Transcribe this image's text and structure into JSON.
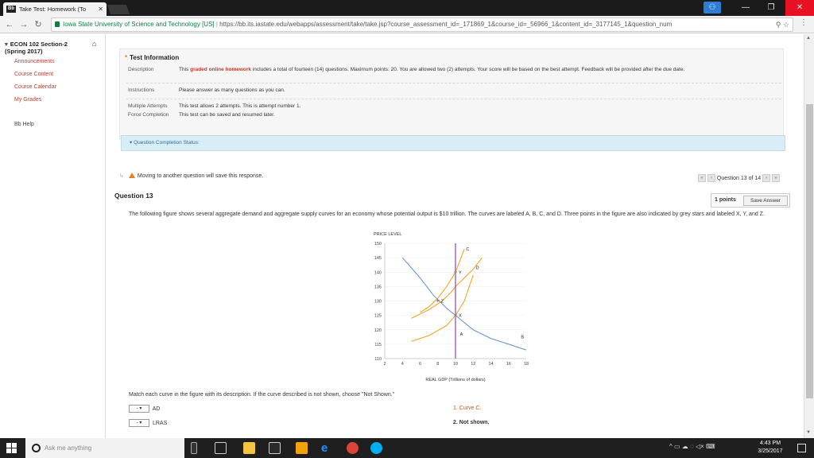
{
  "browser": {
    "tab_title": "Take Test: Homework (To",
    "tab_favicon": "Bb",
    "site_name": "Iowa State University of Science and Technology [US]",
    "url": "https://bb.its.iastate.edu/webapps/assessment/take/take.jsp?course_assessment_id=_171869_1&course_id=_56966_1&content_id=_3177145_1&question_num"
  },
  "leftnav": {
    "course_title": "ECON 102 Section-2",
    "course_term": "(Spring 2017)",
    "items": [
      "Announcements",
      "Course Content",
      "Course Calendar",
      "My Grades"
    ],
    "help": "Bb Help"
  },
  "test_info": {
    "title": "Test Information",
    "rows": [
      {
        "label": "Description",
        "pre": "This ",
        "highlight": "graded online homework",
        "post": " includes a total of fourteen (14) questions. Maximum points: 20. You are allowed two (2) attempts. Your score will be based on the best attempt. Feedback will be provided after the due date."
      },
      {
        "label": "Instructions",
        "value": "Please answer as many questions as you can."
      },
      {
        "label": "Multiple Attempts",
        "value": "This test allows 2 attempts. This is attempt number 1."
      },
      {
        "label": "Force Completion",
        "value": "This test can be saved and resumed later."
      }
    ]
  },
  "question_completion": "Question Completion Status:",
  "warning": "Moving to another question will save this response.",
  "question_nav": {
    "label": "Question 13 of 14"
  },
  "question": {
    "title": "Question 13",
    "points": "1 points",
    "save": "Save Answer",
    "text": "The following figure shows several aggregate demand and aggregate supply curves for an economy whose potential output is $10 trillion. The curves are labeled A, B, C, and D. Three points in the figure are also indicated by grey stars and labeled X, Y, and Z.",
    "match_instruction": "Match each curve in the figure with its description. If the curve described is not shown, choose \"Not Shown.\"",
    "match_rows": [
      {
        "select": "-",
        "term": "AD"
      },
      {
        "select": "-",
        "term": "LRAS"
      }
    ],
    "answers": [
      "1. Curve C.",
      "2. Not shown."
    ]
  },
  "chart_data": {
    "type": "line",
    "ylabel": "PRICE LEVEL",
    "xlabel": "REAL GDP (Trillions of dollars)",
    "xlim": [
      2,
      18
    ],
    "ylim": [
      110,
      150
    ],
    "x_ticks": [
      2,
      4,
      6,
      8,
      10,
      12,
      14,
      16,
      18
    ],
    "y_ticks": [
      110,
      115,
      120,
      125,
      130,
      135,
      140,
      145,
      150
    ],
    "series": [
      {
        "name": "A",
        "color": "#f39c12",
        "points": [
          [
            5,
            116
          ],
          [
            7,
            118
          ],
          [
            9,
            121.5
          ],
          [
            10,
            125
          ],
          [
            11,
            130
          ],
          [
            12,
            139
          ]
        ]
      },
      {
        "name": "B",
        "color": "#5b8fd6",
        "points": [
          [
            4,
            145
          ],
          [
            6,
            138
          ],
          [
            7.5,
            132
          ],
          [
            9,
            127.5
          ],
          [
            10,
            125
          ],
          [
            12,
            120
          ],
          [
            14,
            117
          ],
          [
            16,
            115
          ],
          [
            18,
            113
          ]
        ]
      },
      {
        "name": "C",
        "color": "#f39c12",
        "points": [
          [
            6,
            126
          ],
          [
            7,
            128
          ],
          [
            8,
            131
          ],
          [
            9,
            135
          ],
          [
            10,
            140
          ],
          [
            11,
            148
          ]
        ]
      },
      {
        "name": "D",
        "color": "#f39c12",
        "points": [
          [
            5,
            124
          ],
          [
            7,
            127
          ],
          [
            8.5,
            130
          ],
          [
            9.5,
            133
          ],
          [
            10,
            135
          ],
          [
            11,
            138
          ],
          [
            12,
            141
          ],
          [
            13,
            145
          ]
        ]
      },
      {
        "name": "vertical",
        "color": "#8e44ad",
        "points": [
          [
            10,
            110
          ],
          [
            10,
            150
          ]
        ]
      }
    ],
    "stars": [
      {
        "label": "X",
        "x": 10,
        "y": 125
      },
      {
        "label": "Y",
        "x": 10,
        "y": 140
      },
      {
        "label": "Z",
        "x": 8,
        "y": 130
      }
    ]
  },
  "taskbar": {
    "search_placeholder": "Ask me anything",
    "time": "4:43 PM",
    "date": "3/25/2017"
  }
}
